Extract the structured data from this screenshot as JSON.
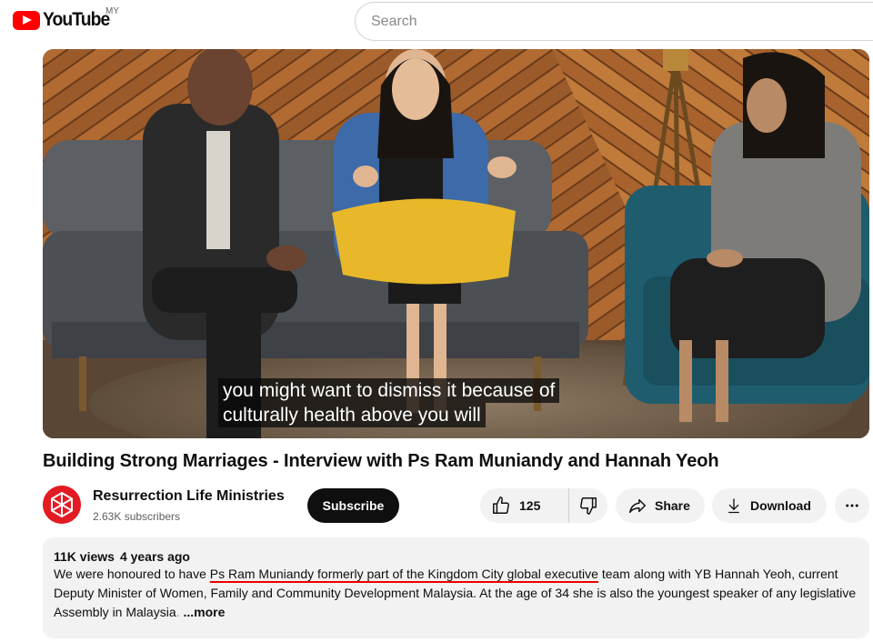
{
  "header": {
    "logo_text": "YouTube",
    "country_code": "MY",
    "search_placeholder": "Search"
  },
  "video": {
    "caption_line1": "you might want to dismiss it because of",
    "caption_line2": "culturally health above you will"
  },
  "title": "Building Strong Marriages - Interview with Ps Ram Muniandy and Hannah Yeoh",
  "channel": {
    "name": "Resurrection Life Ministries",
    "subscribers": "2.63K subscribers",
    "subscribe_label": "Subscribe"
  },
  "actions": {
    "like_count": "125",
    "share_label": "Share",
    "download_label": "Download"
  },
  "description": {
    "views": "11K views",
    "age": "4 years ago",
    "text_before": "We were honoured to have ",
    "text_underlined": "Ps Ram Muniandy formerly part of the Kingdom City global executive",
    "text_after": " team along with YB Hannah Yeoh, current Deputy Minister of Women, Family and Community Development Malaysia. At the age of 34 she is also the youngest speaker of any legislative Assembly in Malaysia",
    "text_faded": ".",
    "more_label": "...more"
  },
  "colors": {
    "brand_red": "#ff0000",
    "subscribe_bg": "#0f0f0f",
    "pill_bg": "#f2f2f2",
    "annotation_underline": "#e00000",
    "avatar_bg": "#e31b23"
  },
  "icons": [
    "youtube-logo-icon",
    "like-icon",
    "dislike-icon",
    "share-icon",
    "download-icon",
    "more-options-icon"
  ]
}
